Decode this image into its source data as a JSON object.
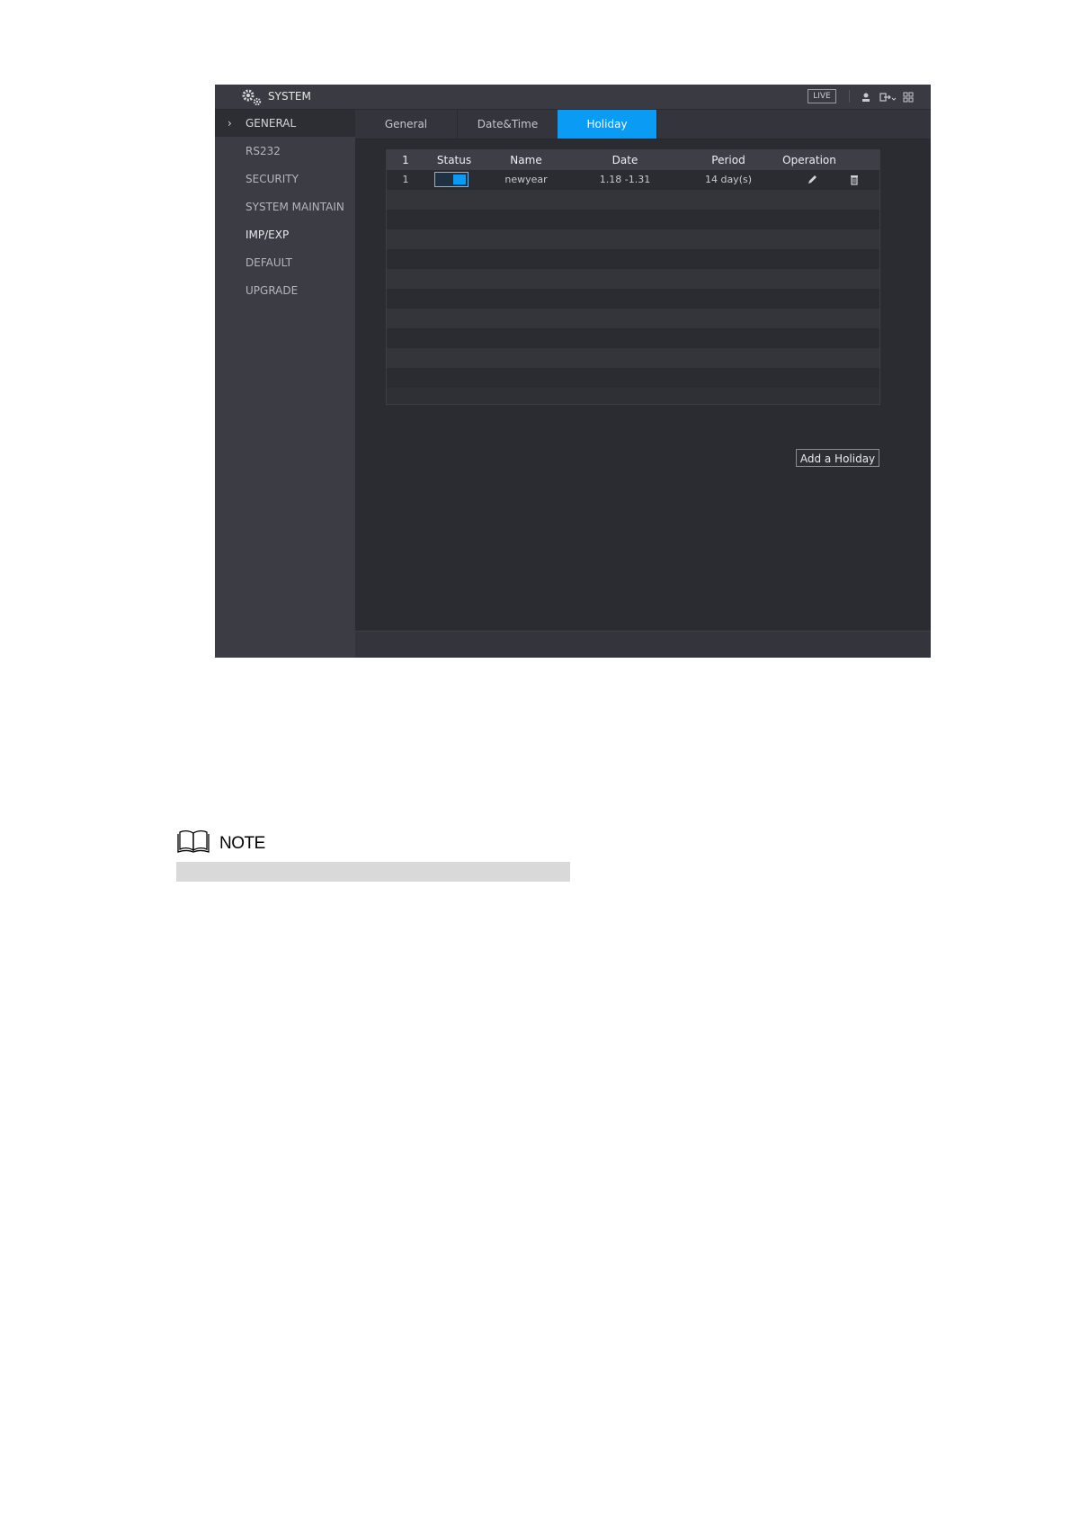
{
  "window": {
    "title": "SYSTEM",
    "live_label": "LIVE",
    "title_icons": [
      "gear-icon",
      "user-icon",
      "logout-icon",
      "grid-icon"
    ]
  },
  "sidebar": {
    "chevron": "›",
    "items": [
      {
        "label": "GENERAL",
        "active": true
      },
      {
        "label": "RS232"
      },
      {
        "label": "SECURITY"
      },
      {
        "label": "SYSTEM MAINTAIN"
      },
      {
        "label": "IMP/EXP"
      },
      {
        "label": "DEFAULT"
      },
      {
        "label": "UPGRADE"
      }
    ]
  },
  "tabs": [
    {
      "label": "General"
    },
    {
      "label": "Date&Time"
    },
    {
      "label": "Holiday",
      "active": true
    }
  ],
  "holiday_table": {
    "headers": {
      "index": "1",
      "status": "Status",
      "name": "Name",
      "date": "Date",
      "period": "Period",
      "operation": "Operation"
    },
    "rows": [
      {
        "index": "1",
        "status_enabled": true,
        "name": "newyear",
        "date": "1.18 -1.31",
        "period": "14 day(s)",
        "operation_icons": [
          "edit-icon",
          "delete-icon"
        ]
      }
    ]
  },
  "buttons": {
    "add_holiday": "Add a Holiday"
  },
  "note": {
    "label": "NOTE",
    "icon": "book-icon"
  },
  "colors": {
    "accent": "#0a9bf5",
    "panel": "#2b2c32",
    "sidebar": "#3b3c44"
  }
}
